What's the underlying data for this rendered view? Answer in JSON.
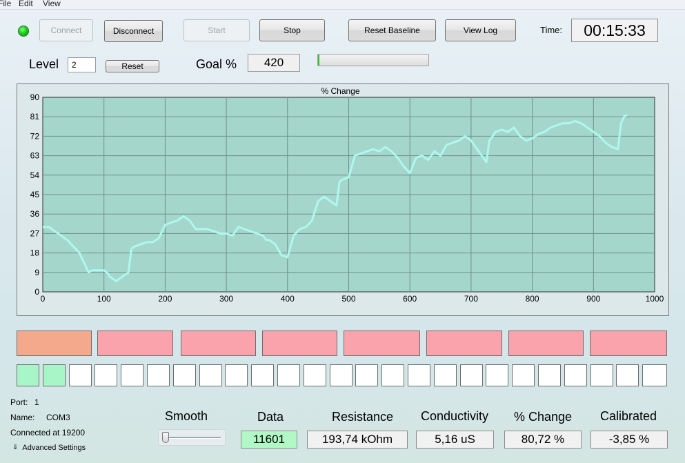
{
  "menu": [
    "File",
    "Edit",
    "View"
  ],
  "toolbar": {
    "connect": "Connect",
    "disconnect": "Disconnect",
    "start": "Start",
    "stop": "Stop",
    "reset_baseline": "Reset Baseline",
    "view_log": "View Log",
    "time_label": "Time:",
    "time_value": "00:15:33"
  },
  "status_led_color": "#19d219",
  "level": {
    "label": "Level",
    "value": "2",
    "reset": "Reset"
  },
  "goal": {
    "label": "Goal %",
    "value": "420",
    "progress_fraction": 0.01
  },
  "chart_data": {
    "type": "line",
    "title": "% Change",
    "xlabel": "",
    "ylabel": "",
    "xlim": [
      0,
      1000
    ],
    "ylim": [
      0,
      90
    ],
    "xticks": [
      0,
      100,
      200,
      300,
      400,
      500,
      600,
      700,
      800,
      900,
      1000
    ],
    "yticks": [
      0,
      9,
      18,
      27,
      36,
      45,
      54,
      63,
      72,
      81,
      90
    ],
    "grid": true,
    "line_color": "#aef8ee",
    "background": "#a5d6cc",
    "series": [
      {
        "x": [
          0,
          10,
          20,
          30,
          40,
          50,
          60,
          70,
          75,
          80,
          90,
          100,
          105,
          110,
          115,
          120,
          125,
          130,
          135,
          140,
          145,
          150,
          160,
          170,
          180,
          190,
          200,
          210,
          220,
          230,
          240,
          250,
          260,
          270,
          280,
          290,
          300,
          310,
          320,
          330,
          340,
          350,
          360,
          365,
          370,
          380,
          390,
          400,
          410,
          420,
          430,
          440,
          450,
          460,
          470,
          480,
          485,
          490,
          500,
          510,
          520,
          530,
          540,
          550,
          560,
          570,
          580,
          590,
          600,
          610,
          620,
          630,
          640,
          650,
          660,
          670,
          680,
          690,
          700,
          710,
          720,
          725,
          730,
          740,
          750,
          760,
          770,
          780,
          790,
          800,
          810,
          820,
          830,
          840,
          850,
          860,
          870,
          880,
          890,
          900,
          910,
          920,
          930,
          940,
          945,
          950,
          955
        ],
        "y": [
          30,
          30,
          28,
          26,
          24,
          21,
          18,
          12,
          9,
          10,
          10,
          10,
          9,
          7,
          6,
          5,
          6,
          7,
          8,
          9,
          20,
          21,
          22,
          23,
          23,
          25,
          31,
          32,
          33,
          35,
          33,
          29,
          29,
          29,
          28,
          27,
          27,
          26,
          30,
          29,
          28,
          27,
          26,
          24,
          24,
          22,
          17,
          16,
          26,
          29,
          30,
          33,
          42,
          44,
          42,
          40,
          51,
          52,
          53,
          63,
          64,
          65,
          66,
          65,
          67,
          65,
          62,
          58,
          55,
          62,
          63,
          61,
          65,
          63,
          68,
          69,
          70,
          72,
          70,
          66,
          62,
          60,
          70,
          74,
          75,
          74,
          76,
          72,
          70,
          71,
          73,
          74,
          76,
          77,
          78,
          78,
          79,
          78,
          76,
          74,
          72,
          69,
          67,
          66,
          78,
          81,
          82
        ]
      }
    ]
  },
  "level_blocks": [
    {
      "color": "#f5a98c"
    },
    {
      "color": "#fba3ad"
    },
    {
      "color": "#fba3ad"
    },
    {
      "color": "#fba3ad"
    },
    {
      "color": "#fba3ad"
    },
    {
      "color": "#fba3ad"
    },
    {
      "color": "#fba3ad"
    },
    {
      "color": "#fba3ad"
    }
  ],
  "indicator_squares": {
    "count": 25,
    "active": 2,
    "active_color": "#a8f5c8",
    "inactive_color": "#ffffff"
  },
  "info": {
    "port_label": "Port:",
    "port_value": "1",
    "name_label": "Name:",
    "name_value": "COM3",
    "connected": "Connected at 19200",
    "advanced": "Advanced Settings"
  },
  "readouts": {
    "smooth_label": "Smooth",
    "data_label": "Data",
    "data_value": "11601",
    "data_color": "#b2f8c6",
    "resistance_label": "Resistance",
    "resistance_value": "193,74 kOhm",
    "conductivity_label": "Conductivity",
    "conductivity_value": "5,16 uS",
    "change_label": "% Change",
    "change_value": "80,72 %",
    "calibrated_label": "Calibrated",
    "calibrated_value": "-3,85 %"
  }
}
